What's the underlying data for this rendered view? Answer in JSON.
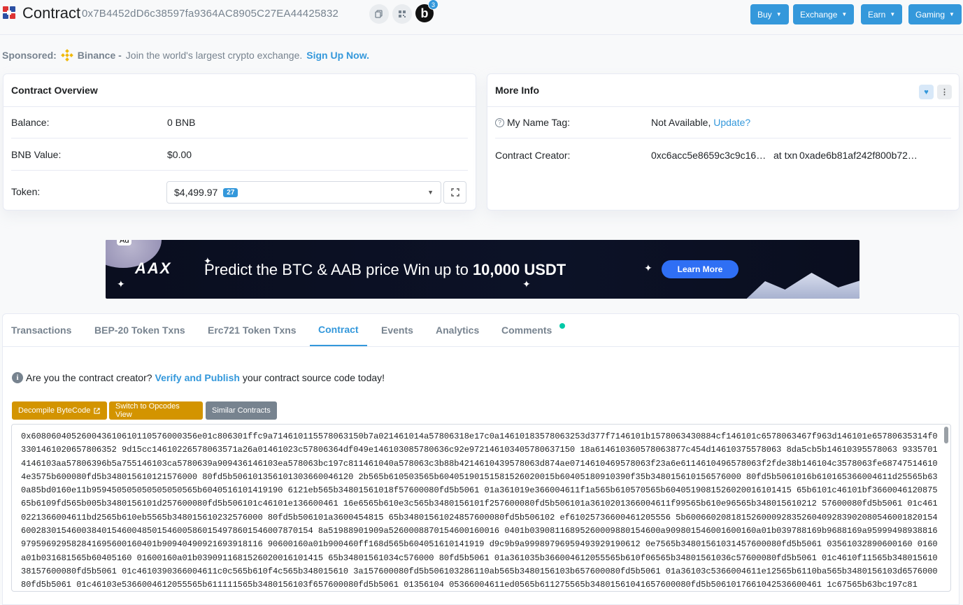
{
  "header": {
    "title": "Contract",
    "address": "0x7B4452dD6c38597fa9364AC8905C27EA44425832",
    "profile_letter": "b",
    "profile_badge": "3",
    "nav": [
      {
        "label": "Buy"
      },
      {
        "label": "Exchange"
      },
      {
        "label": "Earn"
      },
      {
        "label": "Gaming"
      }
    ]
  },
  "sponsored": {
    "label": "Sponsored:",
    "brand": "Binance -",
    "text": "Join the world's largest crypto exchange.",
    "cta": "Sign Up Now."
  },
  "overview": {
    "title": "Contract Overview",
    "balance_label": "Balance:",
    "balance_value": "0 BNB",
    "value_label": "BNB Value:",
    "value_value": "$0.00",
    "token_label": "Token:",
    "token_value": "$4,499.97",
    "token_count": "27"
  },
  "more_info": {
    "title": "More Info",
    "name_tag_label": "My Name Tag:",
    "name_tag_value": "Not Available,",
    "name_tag_link": "Update?",
    "creator_label": "Contract Creator:",
    "creator_address": "0xc6acc5e8659c3c9c16…",
    "at_txn": "at txn",
    "txn_hash": "0xade6b81af242f800b72…"
  },
  "ad": {
    "label": "Ad",
    "brand": "AAX",
    "text_plain": "Predict the BTC & AAB price  Win up to ",
    "text_bold": "10,000 USDT",
    "button": "Learn More"
  },
  "tabs": [
    {
      "label": "Transactions"
    },
    {
      "label": "BEP-20 Token Txns"
    },
    {
      "label": "Erc721 Token Txns"
    },
    {
      "label": "Contract"
    },
    {
      "label": "Events"
    },
    {
      "label": "Analytics"
    },
    {
      "label": "Comments"
    }
  ],
  "contract": {
    "verify_prefix": "Are you the contract creator?",
    "verify_link": "Verify and Publish",
    "verify_suffix": "your contract source code today!",
    "btn_decompile": "Decompile ByteCode",
    "btn_opcodes": "Switch to Opcodes View",
    "btn_similar": "Similar Contracts",
    "bytecode": "0x608060405260043610610110576000356e01c806301ffc9a714610115578063150b7a021461014a57806318e17c0a14610183578063253d377f7146101b1578063430884cf146101c6578063467f963d146101e65780635314f03301461020657806352 9d15cc14610226578063571a26a01461023c57806364df049e146103085780636c92e972146103405780637150 18a614610360578063877c454d14610375578063 8da5cb5b14610395578063 93357014146103aa57806396b5a755146103ca5780639a909436146103ea578063bc197c811461040a578063c3b88b4214610439578063d874ae0714610469578063f23a6e6114610496578063f2fde38b146104c3578063fe687475146104e3575b600080fd5b348015610121576000 80fd5b506101356101303660046120 2b565b610503565b60405190151581526020015b60405180910390f35b348015610156576000 80fd5b5061016b610165366004611d25565b630a85bd0160e11b959450505050505050565b6040516101419190 6121eb565b34801561018f57600080fd5b5061 01a361019e366004611f1a565b610570565b6040519081526020016101415 65b6101c46101bf366004612087565b6109fd565b005b3480156101d257600080fd5b506101c46101e136600461 16e6565b610e3c565b3480156101f257600080fd5b506101a3610201366004611f99565b610e96565b348015610212 57600080fd5b5061 01c4610221366004611bd2565b610eb5565b348015610232576000 80fd5b506101a3600454815 65b34801561024857600080fd5b506102 ef61025736600461205556 5b600660208181526000928352604092839020805460018201546002830154600384015460048501546005860154978601546007870154 8a51988901909a5260008870154600160016 0401b03908116895260009880154600a909801546001600160a01b039788169b9688169a95999498938816979596929582841695600160401b90940490921693918116 90600160a01b900460ff168d565b604051610141919 d9c9b9a99989796959493929190612 0e7565b34801561031457600080fd5b5061 03561032890600160 0160a01b031681565b60405160 01600160a01b0390911681526020016101415 65b34801561034c576000 80fd5b5061 01a361035b366004612055565b610f06565b34801561036c57600080fd5b5061 01c4610f11565b34801561038157600080fd5b5061 01c4610390366004611c0c565b610f4c565b348015610 3a157600080fd5b506103286110ab565b3480156103b657600080fd5b5061 01a36103c5366004611e12565b6110ba565b3480156103d657600080fd5b5061 01c46103e5366004612055565b611111565b3480156103f657600080fd5b5061 01356104 05366004611ed0565b611275565b34801561041657600080fd5b5061017661042536600461 1c67565b63bc197c81"
  }
}
